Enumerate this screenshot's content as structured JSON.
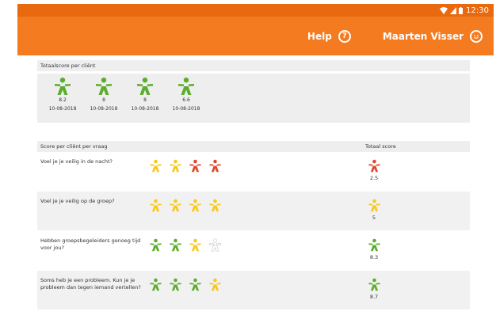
{
  "status_bar": {
    "time": "12:30",
    "icons": [
      "wifi-icon",
      "signal-icon",
      "battery-icon"
    ]
  },
  "app_bar": {
    "help_label": "Help",
    "help_icon": "?",
    "user_name": "Maarten Visser",
    "user_icon": "smiley-icon"
  },
  "total_panel": {
    "title": "Totaalscore per cliënt",
    "cards": [
      {
        "value": "8.2",
        "date": "10-08-2018"
      },
      {
        "value": "8",
        "date": "10-08-2018"
      },
      {
        "value": "8",
        "date": "10-08-2018"
      },
      {
        "value": "6.6",
        "date": "10-08-2018"
      }
    ]
  },
  "question_panel": {
    "title": "Score per cliënt per vraag",
    "total_header": "Totaal score",
    "questions": [
      {
        "text": "Voel je je veilig in de nacht?",
        "stars": [
          "yellow",
          "yellow",
          "red",
          "red"
        ],
        "total": "2.5",
        "total_color": "red"
      },
      {
        "text": "Voel je je veilig op de groep?",
        "stars": [
          "yellow",
          "yellow",
          "yellow",
          "yellow"
        ],
        "total": "5",
        "total_color": "yellow"
      },
      {
        "text": "Hebben groepsbegeleiders genoeg tijd voor jou?",
        "stars": [
          "green",
          "green",
          "yellow",
          "outline"
        ],
        "total": "8.3",
        "total_color": "green"
      },
      {
        "text": "Soms heb je een probleem. Kun je je probleem dan tegen iemand vertellen?",
        "stars": [
          "green",
          "green",
          "green",
          "yellow"
        ],
        "total": "8.7",
        "total_color": "green"
      }
    ]
  },
  "colors": {
    "orange": "#f47b20",
    "green": "#5cac2d",
    "yellow": "#f7c81e",
    "red": "#e0472a",
    "outline": "#cfcfcf"
  }
}
